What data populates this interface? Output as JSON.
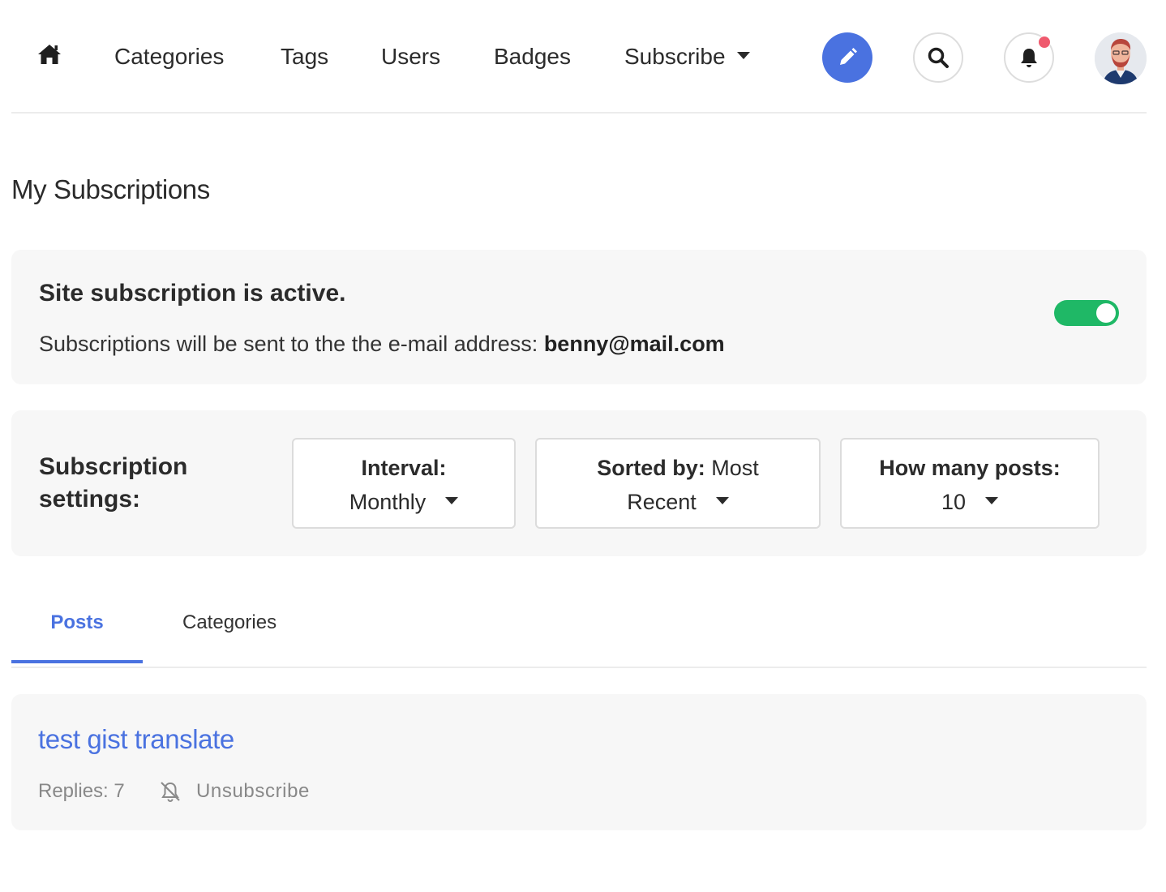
{
  "nav": {
    "home_icon": "home-icon",
    "links": [
      "Categories",
      "Tags",
      "Users",
      "Badges"
    ],
    "subscribe_label": "Subscribe",
    "edit_icon": "pencil-icon",
    "search_icon": "search-icon",
    "notification_icon": "bell-icon",
    "accent_color": "#4a72e0",
    "notification_dot_color": "#ef5a6e"
  },
  "page": {
    "title": "My Subscriptions"
  },
  "site_subscription": {
    "title": "Site subscription is active.",
    "description": "Subscriptions will be sent to the the e-mail address: ",
    "email": "benny@mail.com",
    "toggle_on": true,
    "toggle_color": "#1fb866"
  },
  "settings": {
    "label": "Subscription settings:",
    "interval": {
      "label": "Interval:",
      "value": "Monthly"
    },
    "sorted_by": {
      "label": "Sorted by:",
      "value_first": "Most",
      "value_second": "Recent"
    },
    "how_many": {
      "label": "How many posts:",
      "value": "10"
    }
  },
  "tabs": [
    {
      "label": "Posts",
      "active": true
    },
    {
      "label": "Categories",
      "active": false
    }
  ],
  "posts": [
    {
      "title": "test gist translate",
      "replies": "Replies: 7",
      "unsubscribe_label": "Unsubscribe",
      "unsubscribe_icon": "bell-slash-icon"
    }
  ]
}
